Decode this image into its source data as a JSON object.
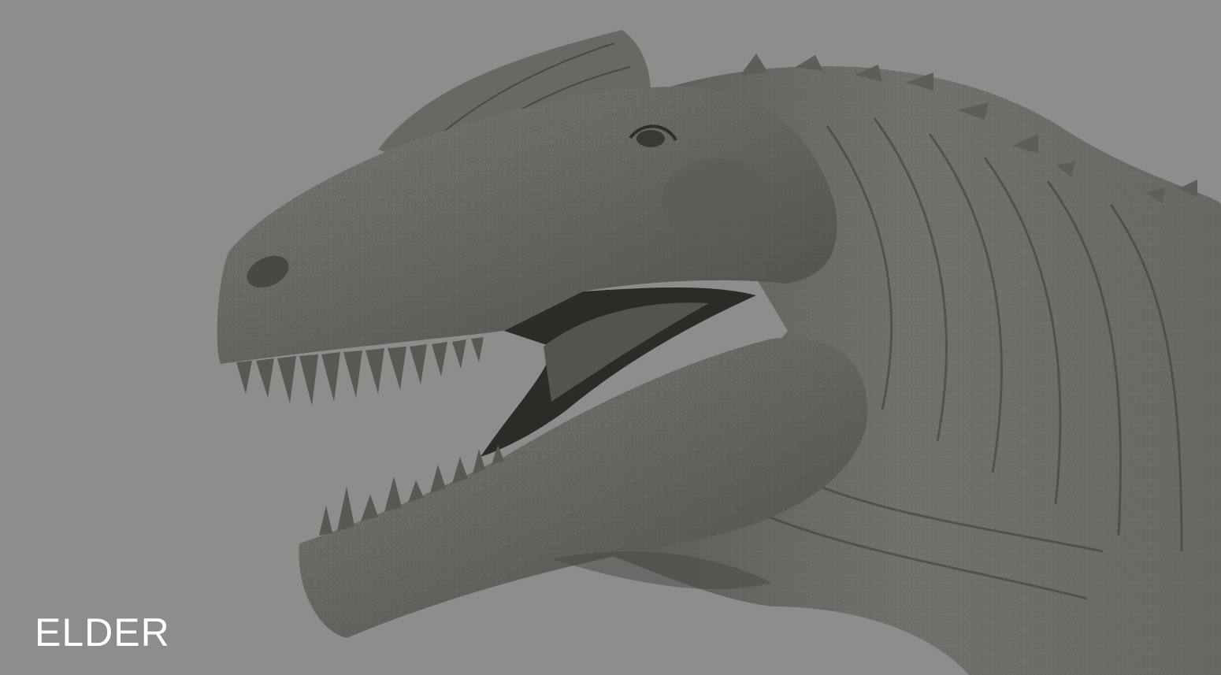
{
  "caption": {
    "text": "ELDER",
    "color": "#ffffff"
  },
  "render": {
    "subject": "dinosaur-head-sculpt",
    "background_color": "#8d8d8d",
    "skin_color": "#6e6c67",
    "shadow_color": "#2a2826"
  }
}
